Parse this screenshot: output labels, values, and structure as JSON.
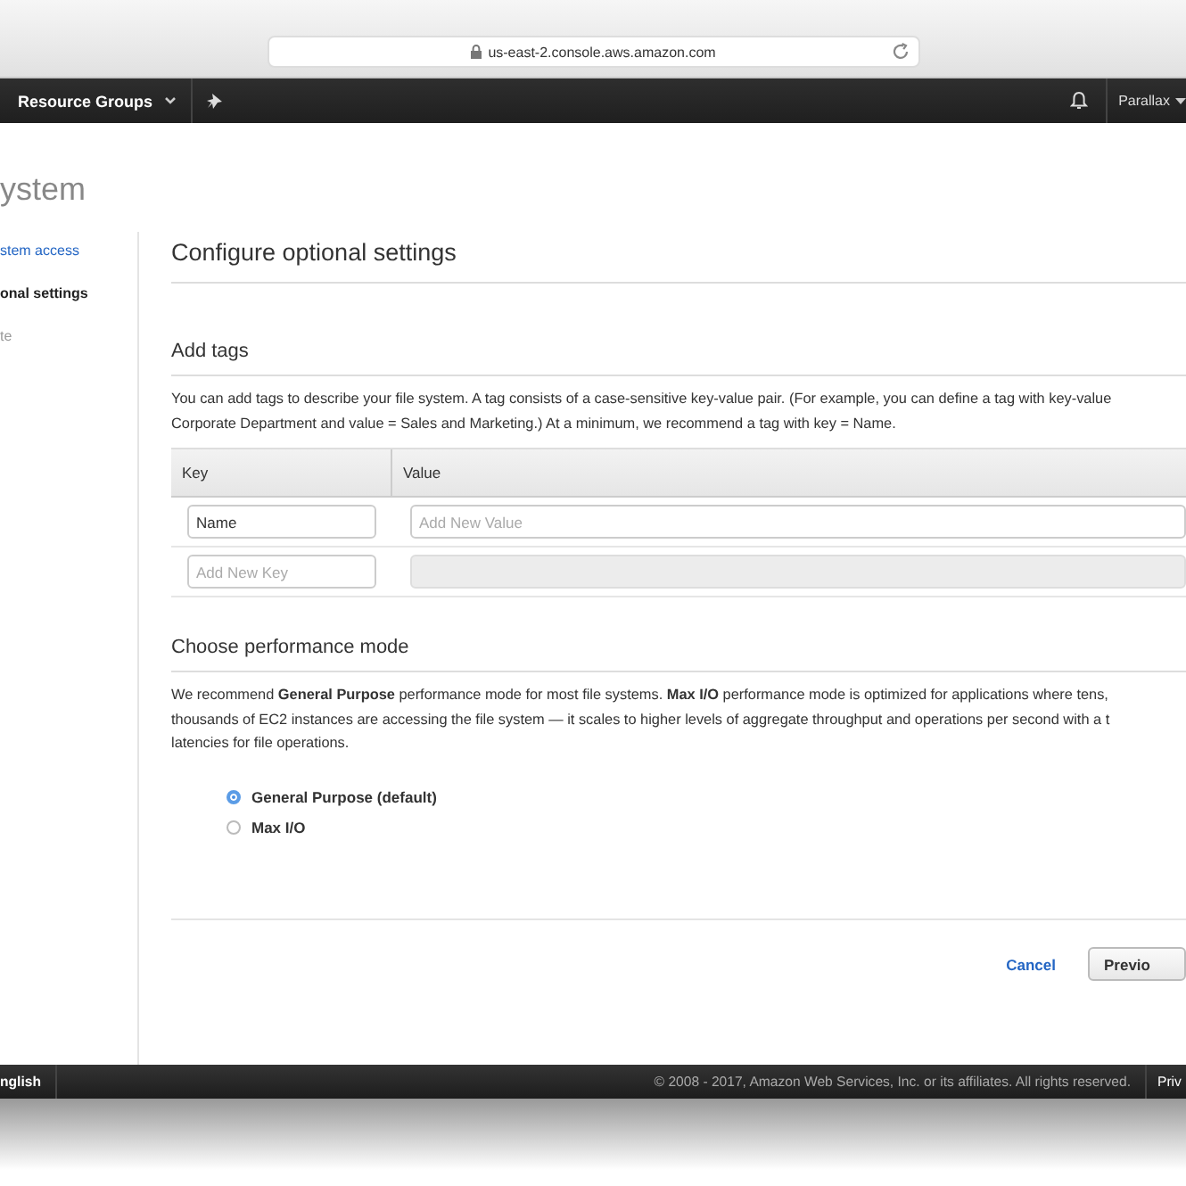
{
  "browser": {
    "url": "us-east-2.console.aws.amazon.com"
  },
  "nav": {
    "menu": "Resource Groups",
    "account": "Parallax"
  },
  "page_title": "ystem",
  "steps": [
    {
      "label": "stem access",
      "kind": "done"
    },
    {
      "label": "onal settings",
      "kind": "current"
    },
    {
      "label": "te",
      "kind": "upcoming"
    }
  ],
  "section_title": "Configure optional settings",
  "tags": {
    "title": "Add tags",
    "description": "You can add tags to describe your file system. A tag consists of a case-sensitive key-value pair. (For example, you can define a tag with key-value\nCorporate Department and value = Sales and Marketing.) At a minimum, we recommend a tag with key = Name.",
    "columns": [
      "Key",
      "Value"
    ],
    "rows": [
      {
        "key": "Name",
        "value_placeholder": "Add New Value",
        "disabled": false
      },
      {
        "key_placeholder": "Add New Key",
        "disabled": true
      }
    ]
  },
  "performance": {
    "title": "Choose performance mode",
    "description": "We recommend **General Purpose** performance mode for most file systems. **Max I/O** performance mode is optimized for applications where tens,\nthousands of EC2 instances are accessing the file system — it scales to higher levels of aggregate throughput and operations per second with a t\nlatencies for file operations.",
    "options": [
      {
        "label": "General Purpose (default)",
        "selected": true
      },
      {
        "label": "Max I/O",
        "selected": false
      }
    ]
  },
  "actions": {
    "cancel": "Cancel",
    "previous": "Previo"
  },
  "footer": {
    "language": "nglish",
    "copyright": "© 2008 - 2017, Amazon Web Services, Inc. or its affiliates. All rights reserved.",
    "privacy": "Priv"
  }
}
